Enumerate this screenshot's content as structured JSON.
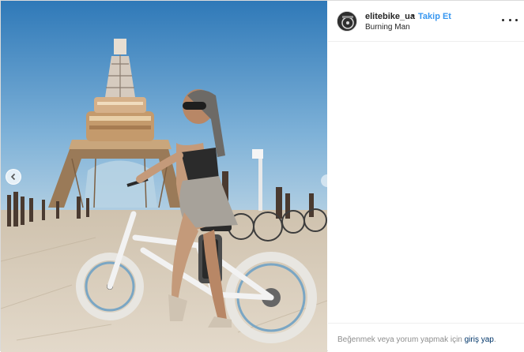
{
  "post": {
    "username": "elitebike_ua",
    "separator": "•",
    "follow_label": "Takip Et",
    "location": "Burning Man",
    "more_options": "more-icon"
  },
  "footer": {
    "prompt_text": "Beğenmek veya yorum yapmak için ",
    "login_label": "giriş yap",
    "end": "."
  },
  "media": {
    "description_icon": "photo",
    "prev_icon": "chevron-left-icon"
  },
  "colors": {
    "accent": "#3897f0",
    "text": "#262626",
    "muted": "#8e8e8e",
    "link": "#003569",
    "sky": "#4f8fc4",
    "ground": "#d9cfbf"
  }
}
